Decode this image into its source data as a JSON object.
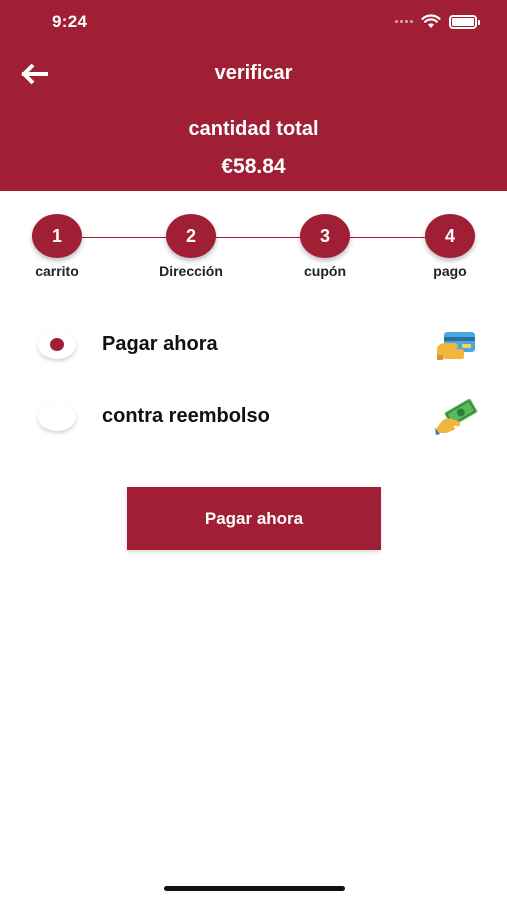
{
  "status_bar": {
    "time": "9:24"
  },
  "header": {
    "title": "verificar",
    "total_label": "cantidad total",
    "total_value": "€58.84",
    "back_icon": "arrow-left-icon"
  },
  "steps": [
    {
      "number": "1",
      "label": "carrito"
    },
    {
      "number": "2",
      "label": "Dirección"
    },
    {
      "number": "3",
      "label": "cupón"
    },
    {
      "number": "4",
      "label": "pago"
    }
  ],
  "payment_options": [
    {
      "label": "Pagar ahora",
      "selected": true,
      "icon": "credit-card-icon"
    },
    {
      "label": "contra reembolso",
      "selected": false,
      "icon": "cash-hand-icon"
    }
  ],
  "pay_button_label": "Pagar ahora",
  "colors": {
    "brand": "#a01f35",
    "background": "#ffffff"
  }
}
